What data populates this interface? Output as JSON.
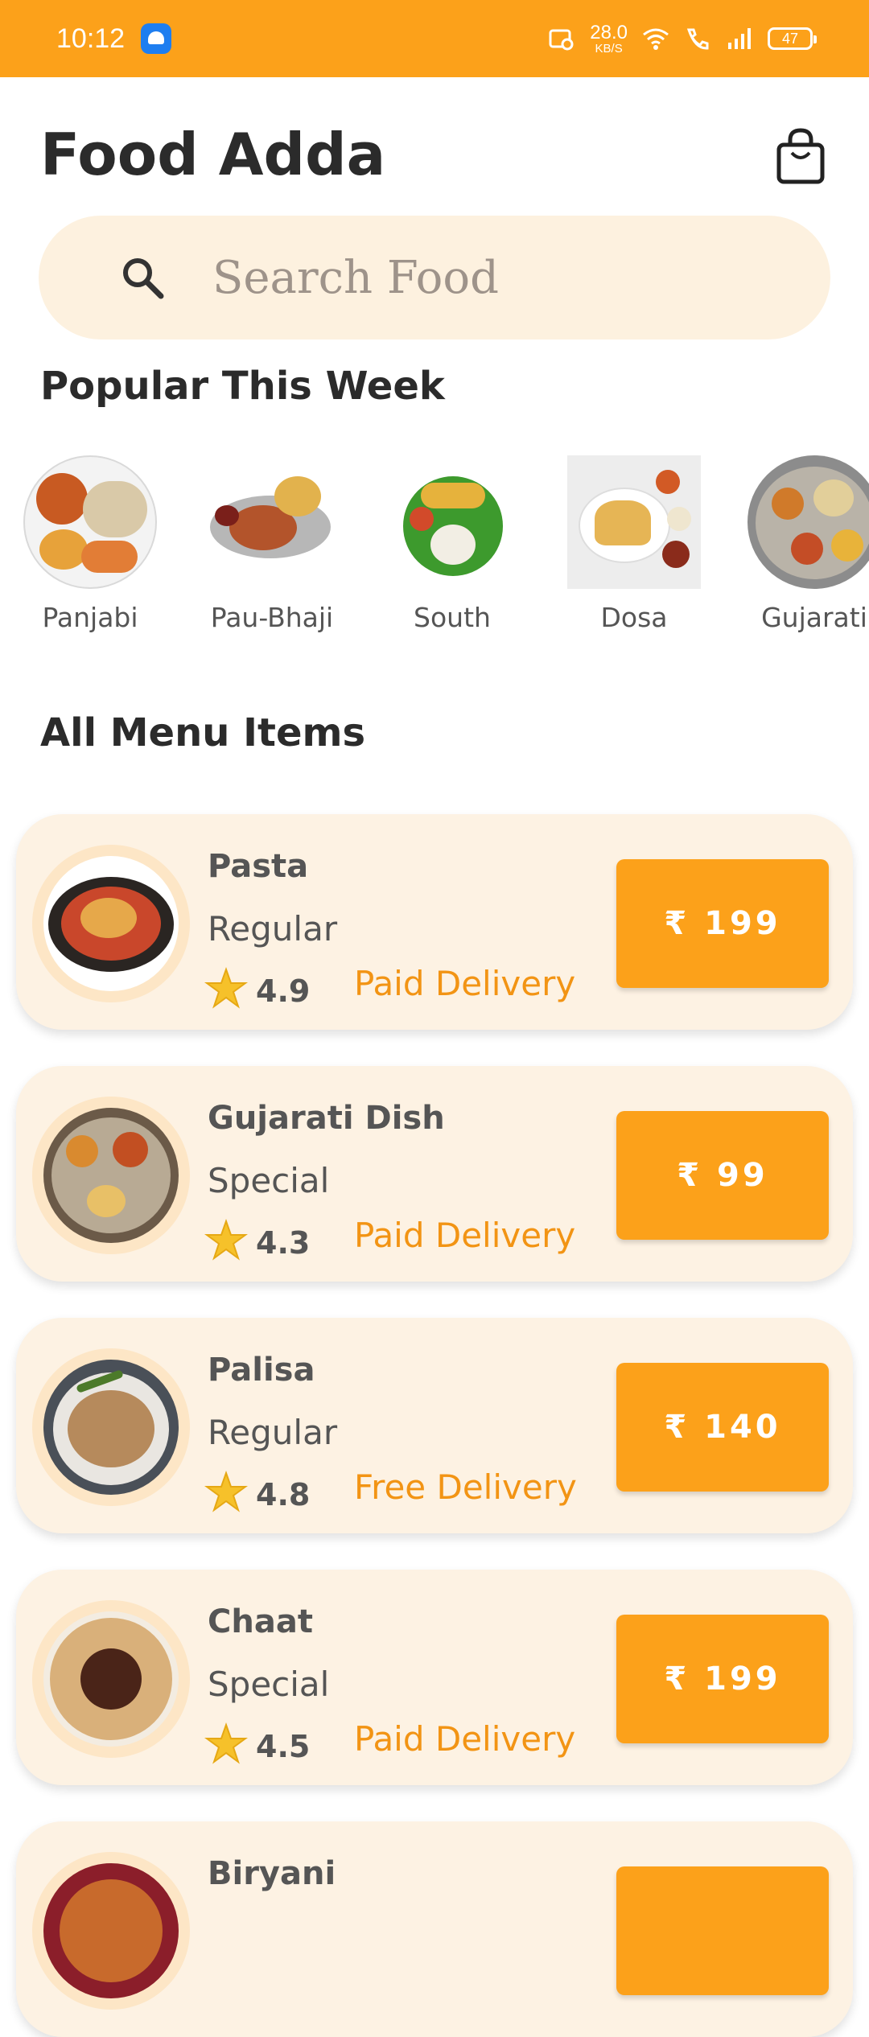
{
  "status_bar": {
    "time": "10:12",
    "speed_value": "28.0",
    "speed_unit": "KB/S",
    "battery": "47",
    "icons": [
      "android-app-icon",
      "screen-record-icon",
      "wifi-icon",
      "wifi-call-icon",
      "signal-icon",
      "battery-icon"
    ]
  },
  "header": {
    "title": "Food Adda",
    "cart_icon": "shopping-bag-icon"
  },
  "search": {
    "placeholder": "Search Food",
    "icon": "search-icon"
  },
  "popular": {
    "title": "Popular This Week",
    "items": [
      {
        "label": "Panjabi"
      },
      {
        "label": "Pau-Bhaji"
      },
      {
        "label": "South"
      },
      {
        "label": "Dosa"
      },
      {
        "label": "Gujarati"
      }
    ]
  },
  "menu": {
    "title": "All Menu Items",
    "items": [
      {
        "name": "Pasta",
        "type": "Regular",
        "rating": "4.9",
        "delivery": "Paid Delivery",
        "price": "₹ 199"
      },
      {
        "name": "Gujarati Dish",
        "type": "Special",
        "rating": "4.3",
        "delivery": "Paid Delivery",
        "price": "₹ 99"
      },
      {
        "name": "Palisa",
        "type": "Regular",
        "rating": "4.8",
        "delivery": "Free Delivery",
        "price": "₹ 140"
      },
      {
        "name": "Chaat",
        "type": "Special",
        "rating": "4.5",
        "delivery": "Paid Delivery",
        "price": "₹ 199"
      },
      {
        "name": "Biryani",
        "type": "",
        "rating": "",
        "delivery": "",
        "price": ""
      }
    ]
  },
  "colors": {
    "accent": "#fca11a",
    "card_bg": "#fdf2e3",
    "search_bg": "#fdf1df",
    "delivery_text": "#f29414"
  }
}
